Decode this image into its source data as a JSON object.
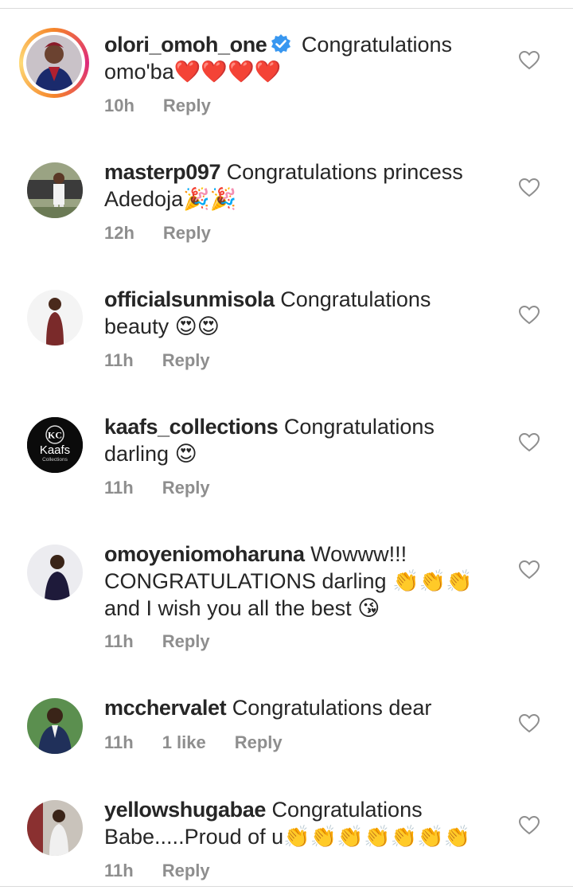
{
  "comments": [
    {
      "username": "olori_omoh_one",
      "verified": true,
      "text": " Congratulations omo'ba",
      "emoji": "❤️❤️❤️❤️",
      "time": "10h",
      "likes": "",
      "reply": "Reply",
      "avatar_color": "#2b2b3a"
    },
    {
      "username": "masterp097",
      "verified": false,
      "text": " Congratulations princess Adedoja",
      "emoji": "🎉🎉",
      "time": "12h",
      "likes": "",
      "reply": "Reply",
      "avatar_color": "#6b7a55"
    },
    {
      "username": "officialsunmisola",
      "verified": false,
      "text": " Congratulations beauty ",
      "emoji": "😍😍",
      "time": "11h",
      "likes": "",
      "reply": "Reply",
      "avatar_color": "#f2f2f2"
    },
    {
      "username": "kaafs_collections",
      "verified": false,
      "text": " Congratulations darling ",
      "emoji": "😍",
      "time": "11h",
      "likes": "",
      "reply": "Reply",
      "avatar_color": "#0b0b0b"
    },
    {
      "username": "omoyeniomoharuna",
      "verified": false,
      "text": " Wowww!!! CONGRATULATIONS darling 👏👏👏 and I wish you all the best ",
      "emoji": "😘",
      "time": "11h",
      "likes": "",
      "reply": "Reply",
      "avatar_color": "#e8e8ee"
    },
    {
      "username": "mcchervalet",
      "verified": false,
      "text": " Congratulations dear",
      "emoji": "",
      "time": "11h",
      "likes": "1 like",
      "reply": "Reply",
      "avatar_color": "#3a6e3a"
    },
    {
      "username": "yellowshugabae",
      "verified": false,
      "text": " Congratulations Babe.....Proud of u",
      "emoji": "👏👏👏👏👏👏👏",
      "time": "11h",
      "likes": "",
      "reply": "Reply",
      "avatar_color": "#7a3b3b"
    }
  ],
  "kaafs_logo": {
    "mark": "KC",
    "name": "Kaafs",
    "sub": "Collections"
  },
  "colors": {
    "text": "#262626",
    "muted": "#8e8e8e",
    "verified": "#3897f0",
    "divider": "#dbdbdb"
  }
}
